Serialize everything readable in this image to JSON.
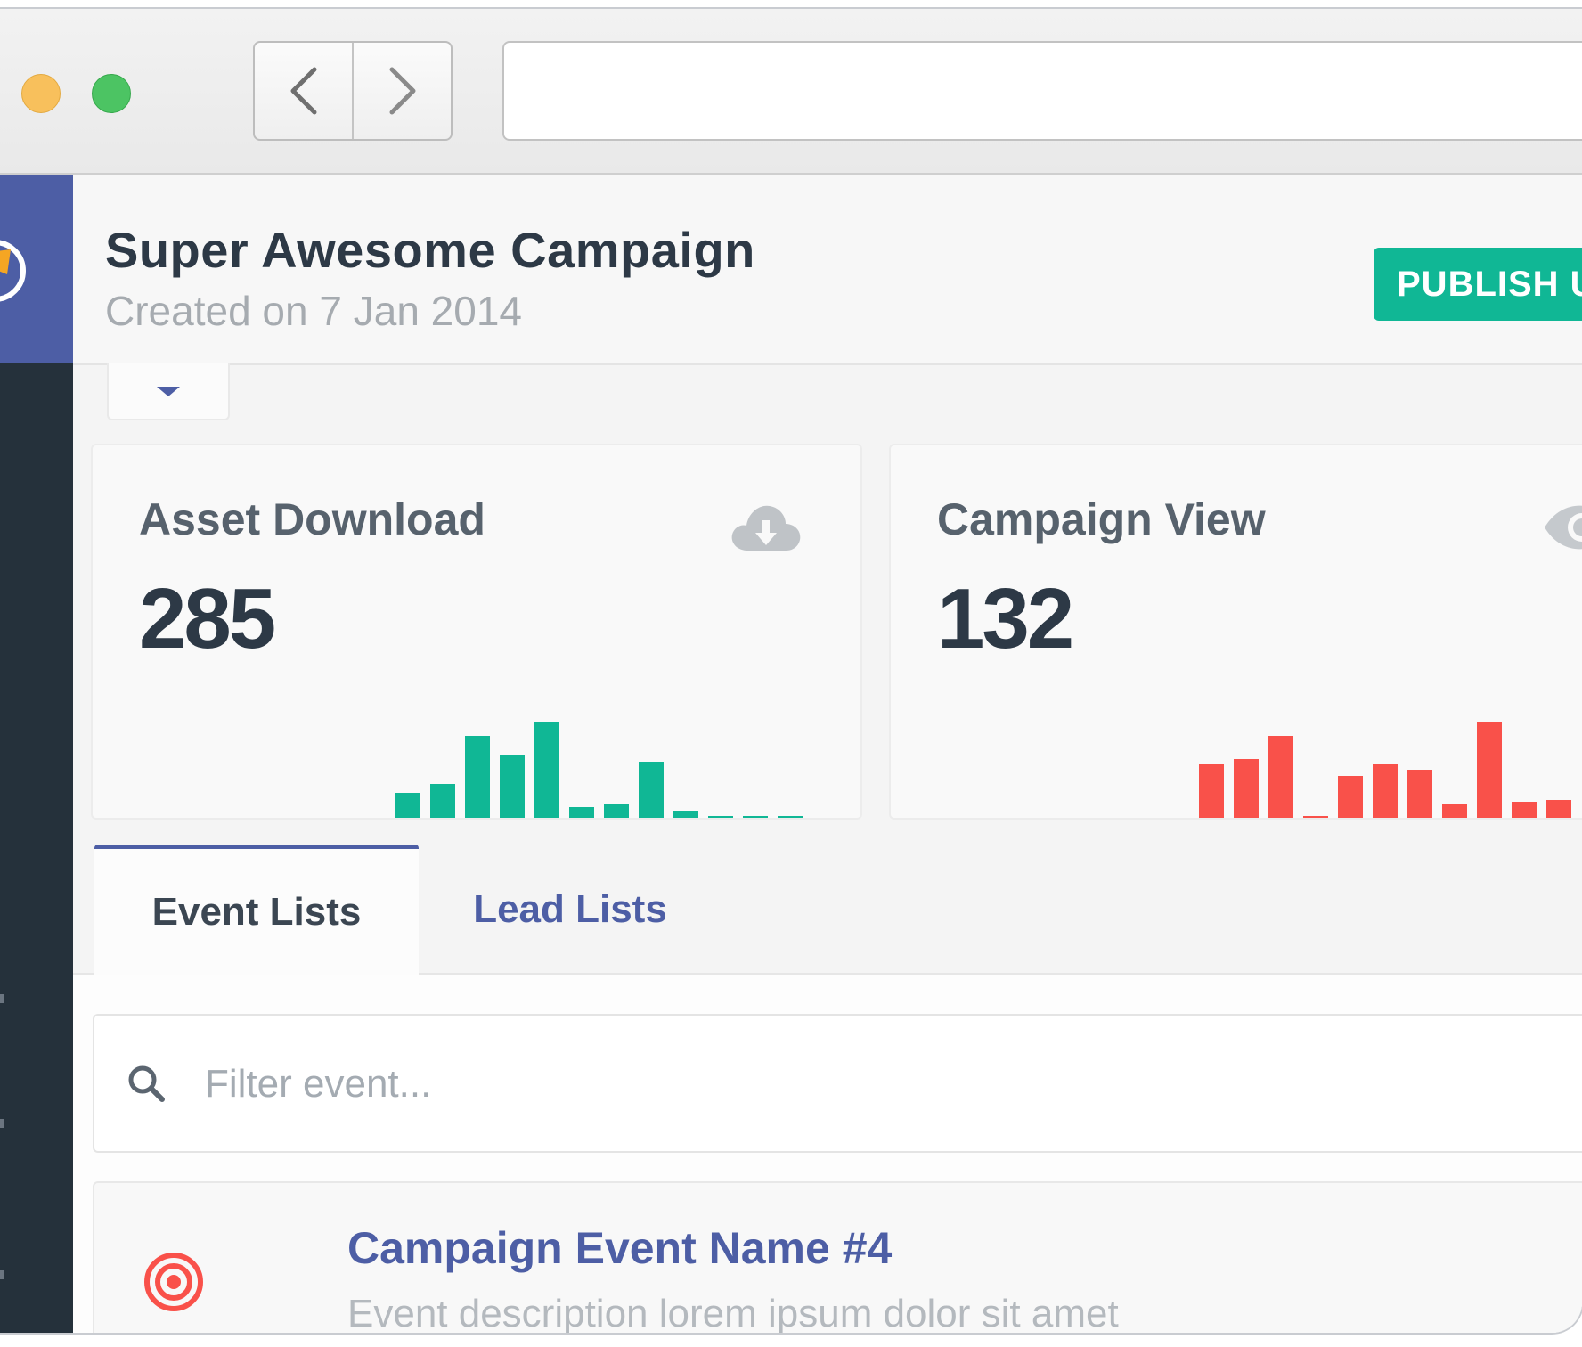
{
  "header": {
    "title": "Super Awesome Campaign",
    "subtitle": "Created on 7 Jan 2014",
    "publish_label": "PUBLISH U"
  },
  "cards": [
    {
      "label": "Asset Download",
      "value": "285",
      "icon": "cloud-download-icon",
      "color": "#10b795",
      "bars": [
        28,
        38,
        92,
        70,
        108,
        12,
        15,
        63,
        8,
        2,
        2,
        2
      ]
    },
    {
      "label": "Campaign View",
      "value": "132",
      "icon": "eye-icon",
      "color": "#f9514a",
      "bars": [
        60,
        66,
        92,
        2,
        47,
        60,
        54,
        15,
        108,
        18,
        20
      ]
    }
  ],
  "tabs": {
    "event_lists": "Event Lists",
    "lead_lists": "Lead Lists"
  },
  "search": {
    "placeholder": "Filter event..."
  },
  "events": [
    {
      "title": "Campaign Event Name #4",
      "description": "Event description lorem ipsum dolor sit amet",
      "icon": "target-icon"
    }
  ],
  "colors": {
    "brand": "#4d5ea5",
    "sidebar": "#25313b",
    "accent_green": "#10b795",
    "accent_red": "#f9514a"
  }
}
